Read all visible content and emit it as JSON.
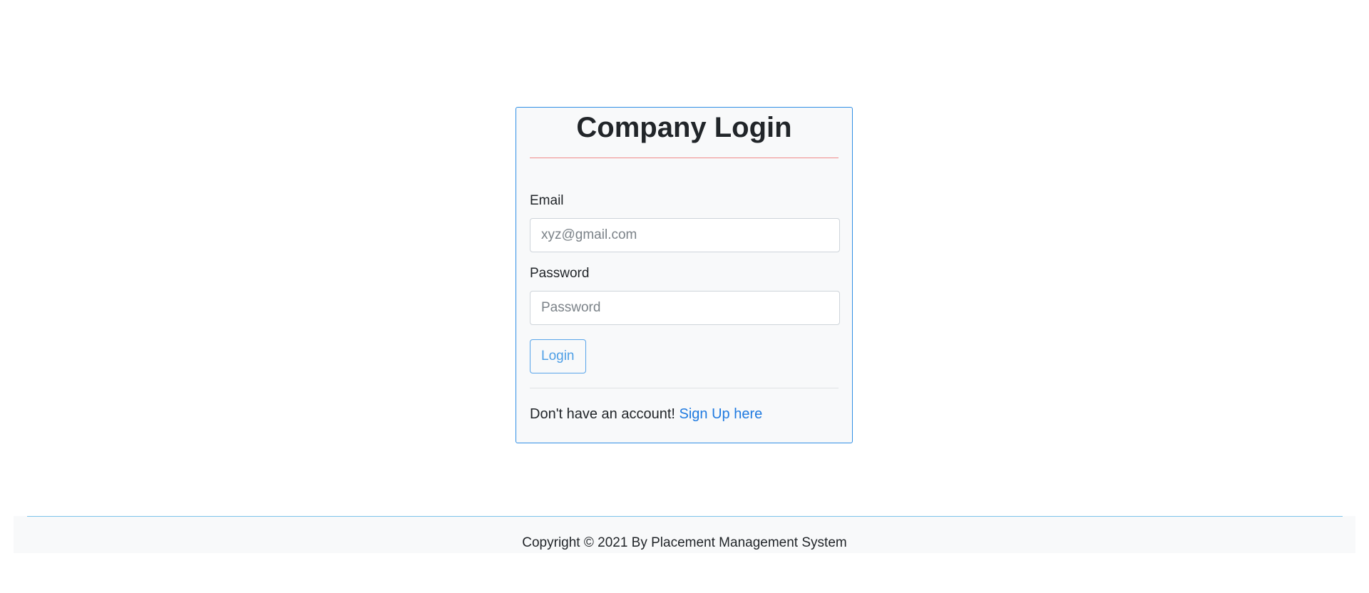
{
  "login_card": {
    "title": "Company Login",
    "email_label": "Email",
    "email_placeholder": "xyz@gmail.com",
    "email_value": "",
    "password_label": "Password",
    "password_placeholder": "Password",
    "password_value": "",
    "login_button_label": "Login",
    "signup_prompt": "Don't have an account! ",
    "signup_link_label": "Sign Up here"
  },
  "footer": {
    "copyright_text": "Copyright © 2021 By Placement Management System"
  },
  "colors": {
    "card_border": "#2f8ee5",
    "title_rule": "#f08a8a",
    "link": "#1f7ae0",
    "footer_rule": "#7cc3ea"
  }
}
